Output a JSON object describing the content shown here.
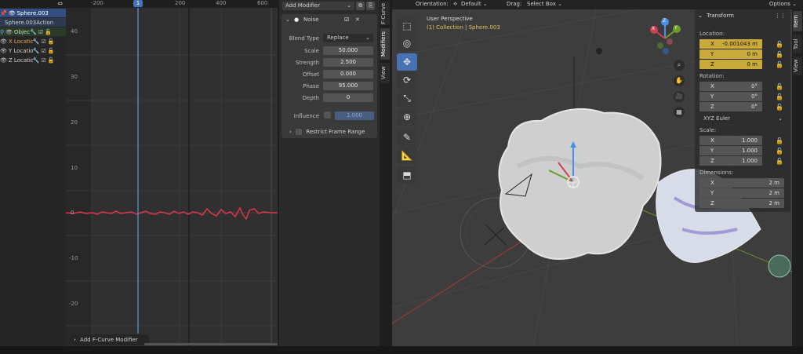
{
  "outliner": {
    "items": [
      {
        "label": "Sphere.003",
        "selected": true
      },
      {
        "label": "Sphere.003Action"
      },
      {
        "label": "Objec"
      },
      {
        "label": "X Locatio",
        "color": "#e0a64a"
      },
      {
        "label": "Y Locatio"
      },
      {
        "label": "Z Locatio"
      }
    ]
  },
  "graph": {
    "frame_ticks": [
      "-200",
      "200",
      "400",
      "600"
    ],
    "current_frame": "1",
    "y_ticks": [
      "40",
      "30",
      "20",
      "10",
      "0",
      "-10",
      "-20"
    ],
    "add_modifier_footer": "Add F-Curve Modifier"
  },
  "modifier_panel": {
    "add_modifier_label": "Add Modifier",
    "noise": {
      "title": "Noise",
      "blend_type_label": "Blend Type",
      "blend_type_value": "Replace",
      "fields": [
        {
          "label": "Scale",
          "value": "50.000"
        },
        {
          "label": "Strength",
          "value": "2.500"
        },
        {
          "label": "Offset",
          "value": "0.000"
        },
        {
          "label": "Phase",
          "value": "95.000"
        },
        {
          "label": "Depth",
          "value": "0"
        }
      ],
      "influence_label": "Influence",
      "influence_value": "1.000",
      "restrict_label": "Restrict Frame Range"
    },
    "tabs": [
      "F-Curve",
      "Modifiers",
      "View"
    ]
  },
  "viewport_header": {
    "orientation_label": "Orientation:",
    "orientation_value": "Default",
    "drag_label": "Drag:",
    "drag_value": "Select Box",
    "options_label": "Options"
  },
  "viewport": {
    "perspective": "User Perspective",
    "collection": "(1) Collection | Sphere.003",
    "gizmo_axes": [
      "Z",
      "Y",
      "X"
    ]
  },
  "transform": {
    "title": "Transform",
    "location_label": "Location:",
    "location": [
      {
        "axis": "X",
        "value": "-0.001043 m"
      },
      {
        "axis": "Y",
        "value": "0 m"
      },
      {
        "axis": "Z",
        "value": "0 m"
      }
    ],
    "rotation_label": "Rotation:",
    "rotation": [
      {
        "axis": "X",
        "value": "0°"
      },
      {
        "axis": "Y",
        "value": "0°"
      },
      {
        "axis": "Z",
        "value": "0°"
      }
    ],
    "rotation_mode": "XYZ Euler",
    "scale_label": "Scale:",
    "scale": [
      {
        "axis": "X",
        "value": "1.000"
      },
      {
        "axis": "Y",
        "value": "1.000"
      },
      {
        "axis": "Z",
        "value": "1.000"
      }
    ],
    "dimensions_label": "Dimensions:",
    "dimensions": [
      {
        "axis": "X",
        "value": "2 m"
      },
      {
        "axis": "Y",
        "value": "2 m"
      },
      {
        "axis": "Z",
        "value": "2 m"
      }
    ]
  },
  "sidebar_tabs": [
    "Item",
    "Tool",
    "View"
  ],
  "colors": {
    "accent": "#4772b3",
    "highlight": "#c9a93a",
    "curve": "#e0344d",
    "frame": "#5680c2"
  }
}
